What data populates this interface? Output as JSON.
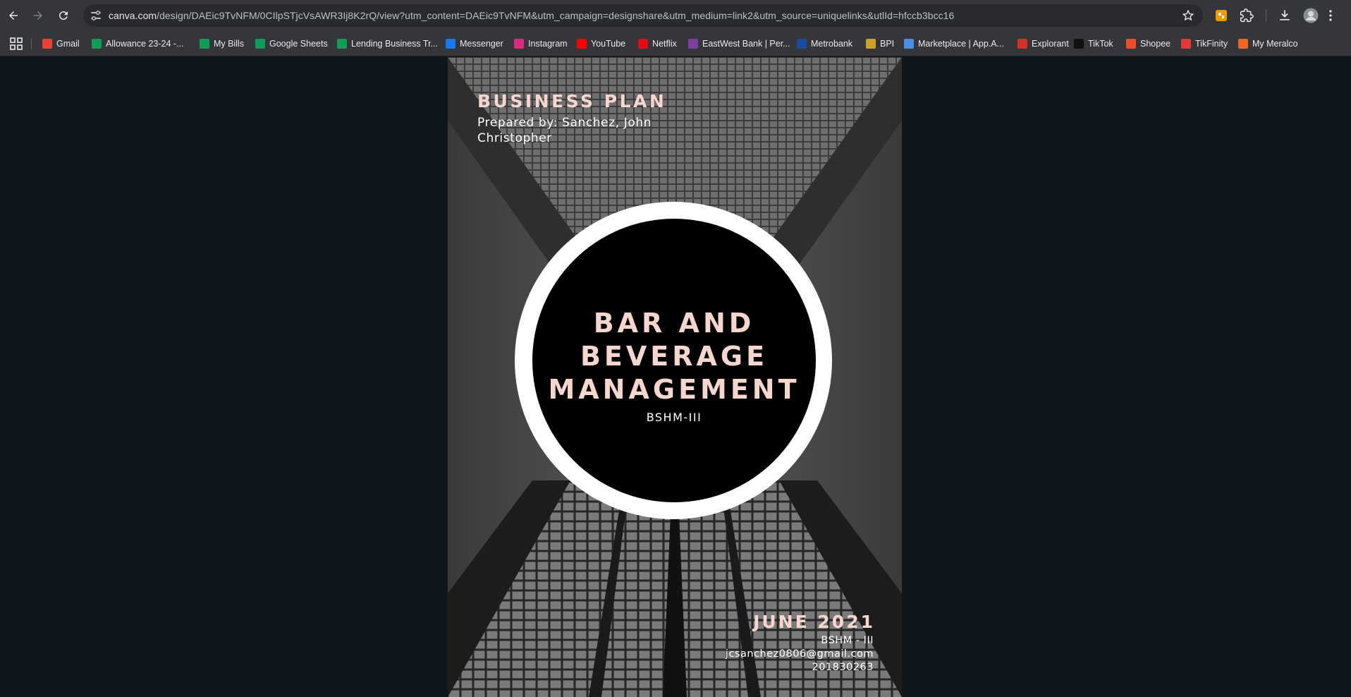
{
  "browser": {
    "url_domain": "canva.com",
    "url_path": "/design/DAEic9TvNFM/0CIlpSTjcVsAWR3Ij8K2rQ/view?utm_content=DAEic9TvNFM&utm_campaign=designshare&utm_medium=link2&utm_source=uniquelinks&utlId=hfccb3bcc16"
  },
  "bookmarks": [
    {
      "label": "Gmail",
      "icon": "gmail-icon",
      "color": "#ea4335"
    },
    {
      "label": "Allowance 23-24 -...",
      "icon": "sheets-icon",
      "color": "#0f9d58"
    },
    {
      "label": "My Bills",
      "icon": "sheets-icon",
      "color": "#0f9d58"
    },
    {
      "label": "Google Sheets",
      "icon": "sheets-icon",
      "color": "#0f9d58"
    },
    {
      "label": "Lending Business Tr...",
      "icon": "sheets-icon",
      "color": "#0f9d58"
    },
    {
      "label": "Messenger",
      "icon": "facebook-icon",
      "color": "#1877f2"
    },
    {
      "label": "Instagram",
      "icon": "instagram-icon",
      "color": "#dd2a7b"
    },
    {
      "label": "YouTube",
      "icon": "youtube-icon",
      "color": "#ff0000"
    },
    {
      "label": "Netflix",
      "icon": "netflix-icon",
      "color": "#e50914"
    },
    {
      "label": "EastWest Bank | Per...",
      "icon": "eastwest-icon",
      "color": "#7b3fa0"
    },
    {
      "label": "Metrobank",
      "icon": "metrobank-icon",
      "color": "#1a4ba0"
    },
    {
      "label": "BPI",
      "icon": "bpi-icon",
      "color": "#c9a227"
    },
    {
      "label": "Marketplace | App.A...",
      "icon": "marketplace-icon",
      "color": "#4a8fe7"
    },
    {
      "label": "Explorant",
      "icon": "explorant-icon",
      "color": "#d93025"
    },
    {
      "label": "TikTok",
      "icon": "tiktok-icon",
      "color": "#111111"
    },
    {
      "label": "Shopee",
      "icon": "shopee-icon",
      "color": "#ee4d2d"
    },
    {
      "label": "TikFinity",
      "icon": "tikfinity-icon",
      "color": "#e53935"
    },
    {
      "label": "My Meralco",
      "icon": "meralco-icon",
      "color": "#f26522"
    }
  ],
  "cover": {
    "heading": "BUSINESS PLAN",
    "prepared_line1": "Prepared by: Sanchez, John",
    "prepared_line2": "Christopher",
    "title_line1": "BAR AND",
    "title_line2": "BEVERAGE",
    "title_line3": "MANAGEMENT",
    "subtitle": "BSHM-III",
    "date": "JUNE 2021",
    "section": "BSHM - III",
    "email": "jcsanchez0806@gmail.com",
    "student_id": "201830263"
  }
}
